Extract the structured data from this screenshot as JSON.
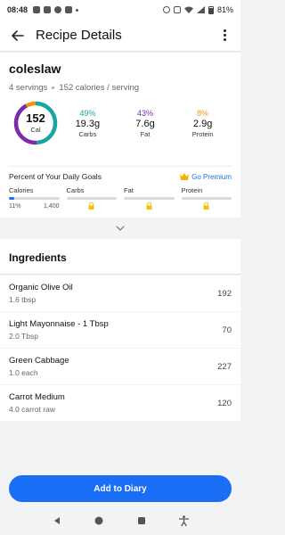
{
  "status_bar": {
    "time": "08:48",
    "battery": "81%"
  },
  "app_bar": {
    "title": "Recipe Details"
  },
  "recipe": {
    "name": "coleslaw",
    "servings": "4 servings",
    "calories_per_serving": "152 calories / serving"
  },
  "ring": {
    "calories": "152",
    "unit": "Cal",
    "carbs_fraction": 0.49,
    "fat_fraction": 0.43,
    "protein_fraction": 0.08
  },
  "macros": [
    {
      "pct": "49%",
      "amount": "19.3g",
      "name": "Carbs",
      "color": "#1aa6a0"
    },
    {
      "pct": "43%",
      "amount": "7.6g",
      "name": "Fat",
      "color": "#7b2aa8"
    },
    {
      "pct": "8%",
      "amount": "2.9g",
      "name": "Protein",
      "color": "#e39a1b"
    }
  ],
  "goals": {
    "title": "Percent of Your Daily Goals",
    "premium_label": "Go Premium",
    "calories": {
      "label": "Calories",
      "pct": "11%",
      "goal": "1,400",
      "fill_fraction": 0.11
    },
    "carbs": {
      "label": "Carbs"
    },
    "fat": {
      "label": "Fat"
    },
    "protein": {
      "label": "Protein"
    }
  },
  "ingredients": {
    "title": "Ingredients",
    "items": [
      {
        "name": "Organic Olive Oil",
        "qty": "1.6 tbsp",
        "cal": "192"
      },
      {
        "name": "Light Mayonnaise - 1 Tbsp",
        "qty": "2.0 Tbsp",
        "cal": "70"
      },
      {
        "name": "Green Cabbage",
        "qty": "1.0 each",
        "cal": "227"
      },
      {
        "name": "Carrot Medium",
        "qty": "4.0 carrot raw",
        "cal": "120"
      }
    ]
  },
  "add_button": {
    "label": "Add to Diary"
  },
  "colors": {
    "accent": "#1a6ef5",
    "premium": "#1a73e8",
    "carbs": "#1aa6a0",
    "fat": "#7b2aa8",
    "protein": "#e39a1b",
    "lock": "#f2c200"
  }
}
